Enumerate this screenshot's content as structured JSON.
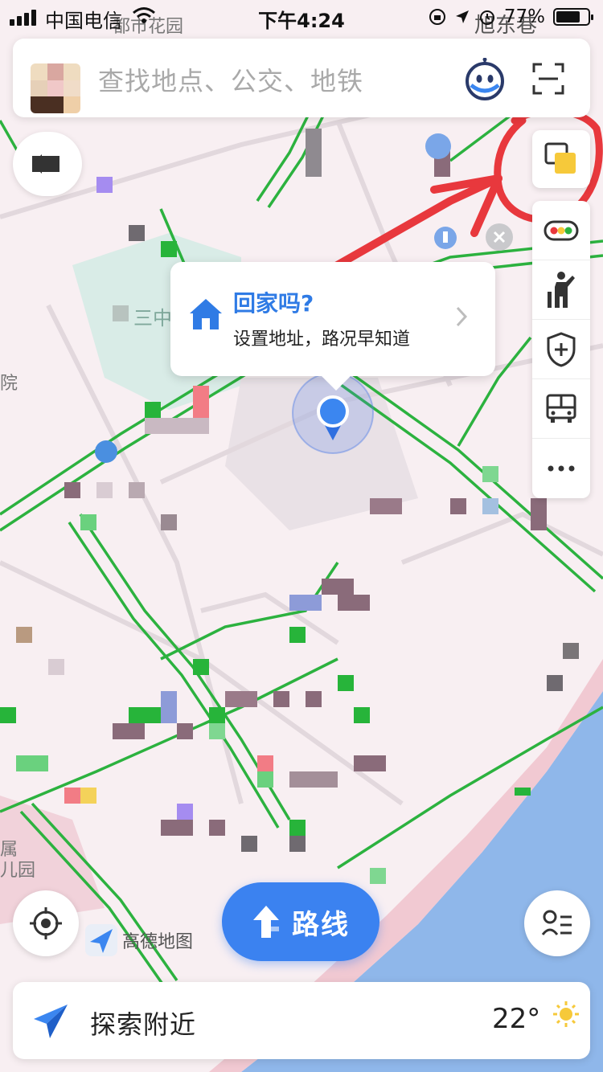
{
  "status_bar": {
    "carrier": "中国电信",
    "time": "下午4:24",
    "battery": "77%",
    "battery_level": 0.77
  },
  "search": {
    "placeholder": "查找地点、公交、地铁"
  },
  "map_labels": {
    "top_place": "都市花园",
    "top_right_street": "旭东巷",
    "left_edge_1": "院",
    "left_bottom": "属",
    "left_bottom_2": "儿园",
    "school": "三中"
  },
  "popup": {
    "title": "回家吗?",
    "subtitle": "设置地址，路况早知道"
  },
  "route_button": {
    "label": "路线"
  },
  "logo": {
    "label": "高德地图"
  },
  "explore": {
    "label": "探索附近",
    "temperature": "22°"
  },
  "toolbar": {
    "items": [
      "layers-icon",
      "traffic-icon",
      "person-icon",
      "shield-plus-icon",
      "bus-icon",
      "more-icon"
    ]
  },
  "colors": {
    "accent": "#3b82f0",
    "road_green": "#2cb23f",
    "water": "#8fb7ea",
    "map_bg": "#f7eef1",
    "annotation_red": "#e8383d"
  }
}
